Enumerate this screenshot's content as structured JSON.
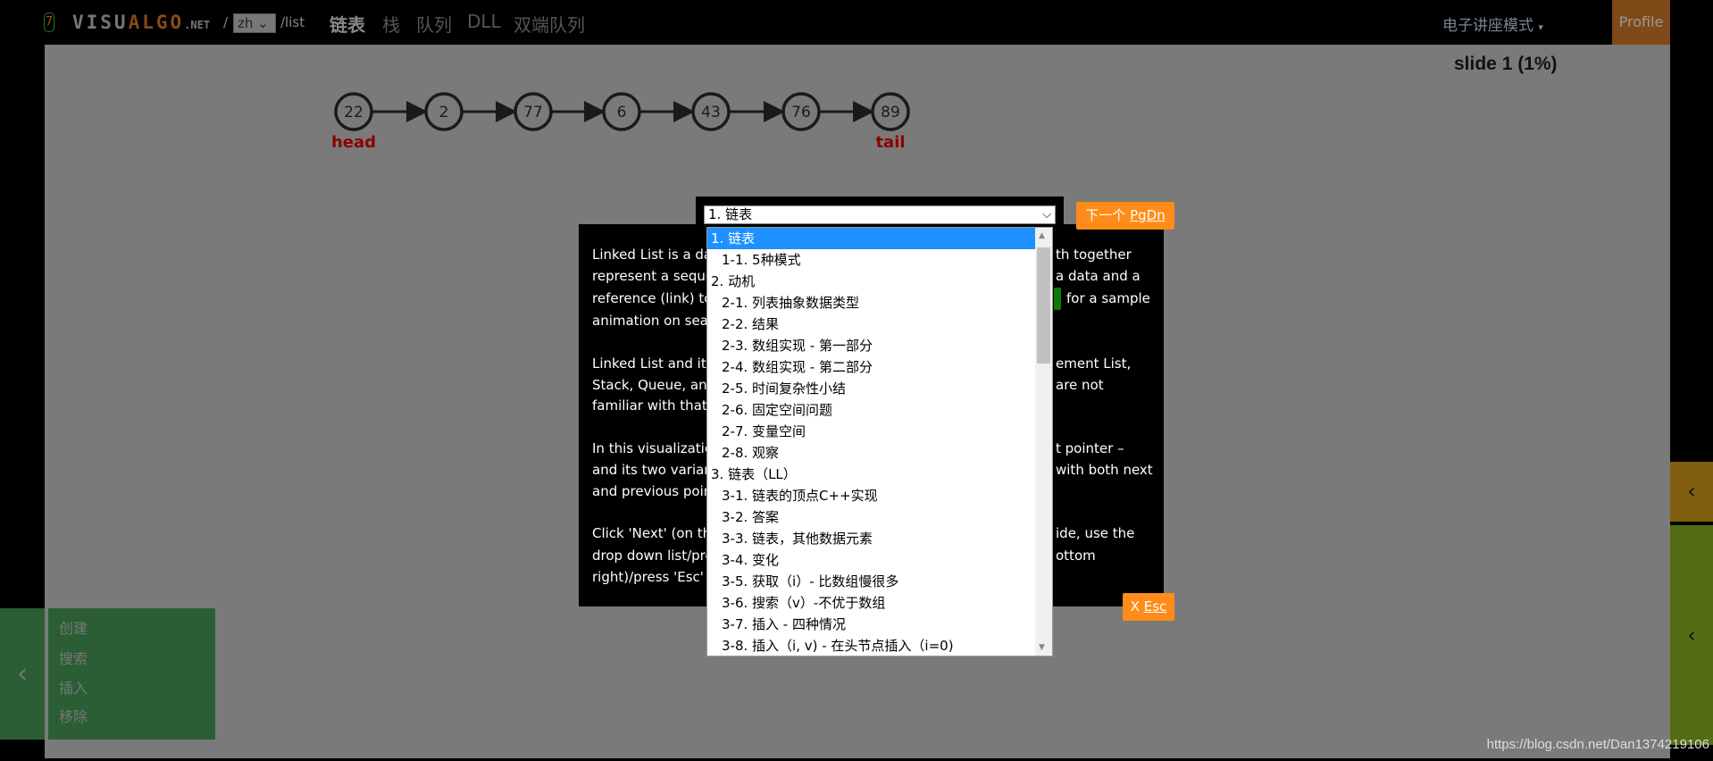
{
  "header": {
    "logo_badge": "7",
    "brand_a": "VISU",
    "brand_b": "ALGO",
    "brand_c": ".NET",
    "slash": "/",
    "lang": "zh",
    "path": "/list",
    "nav": [
      "链表",
      "栈",
      "队列",
      "DLL",
      "双端队列"
    ],
    "mode": "电子讲座模式",
    "mode_caret": "▾",
    "profile": "Profile"
  },
  "slide_status": "slide 1 (1%)",
  "linked_list": {
    "values": [
      "22",
      "2",
      "77",
      "6",
      "43",
      "76",
      "89"
    ],
    "head_label": "head",
    "tail_label": "tail"
  },
  "dialog": {
    "lines": [
      {
        "left": "Linked List is a dat",
        "right": "th together"
      },
      {
        "left": "represent a sequer",
        "right": "a data and a"
      },
      {
        "left": "reference (link) to",
        "right": "for a sample"
      },
      {
        "left": "animation on searc",
        "right": ""
      },
      {
        "left": "Linked List and its",
        "right": "ement List,"
      },
      {
        "left": "Stack, Queue, and",
        "right": "are not"
      },
      {
        "left": "familiar with that",
        "right": ""
      },
      {
        "left": "In this visualizatio",
        "right": "t pointer –"
      },
      {
        "left": "and its two variant",
        "right": "with both next"
      },
      {
        "left": "and previous point",
        "right": ""
      },
      {
        "left": "Click 'Next' (on the",
        "right": "ide, use the"
      },
      {
        "left": "drop down list/pre",
        "right": "ottom"
      },
      {
        "left": "right)/press 'Esc' to",
        "right": ""
      }
    ]
  },
  "slide_select": {
    "value": "1. 链表",
    "options": [
      "1. 链表",
      "1-1. 5种模式",
      "2. 动机",
      "2-1. 列表抽象数据类型",
      "2-2. 结果",
      "2-3. 数组实现 - 第一部分",
      "2-4. 数组实现 - 第二部分",
      "2-5. 时间复杂性小结",
      "2-6. 固定空间问题",
      "2-7. 变量空间",
      "2-8. 观察",
      "3. 链表（LL）",
      "3-1. 链表的顶点C++实现",
      "3-2. 答案",
      "3-3. 链表，其他数据元素",
      "3-4. 变化",
      "3-5. 获取（i）- 比数组慢很多",
      "3-6. 搜索（v）-不优于数组",
      "3-7. 插入 - 四种情况",
      "3-8. 插入（i, v) - 在头节点插入（i=0)"
    ]
  },
  "next_button": {
    "label": "下一个 ",
    "key": "PgDn"
  },
  "esc_button": {
    "label": "X ",
    "key": "Esc"
  },
  "left_menu": {
    "items": [
      "创建",
      "搜索",
      "插入",
      "移除"
    ]
  },
  "watermark": "https://blog.csdn.net/Dan1374219106",
  "colors": {
    "accent": "#ff8c1a",
    "selected": "#1e90ff",
    "menu_green": "#2b5e34",
    "head_tail": "#8b0000"
  }
}
